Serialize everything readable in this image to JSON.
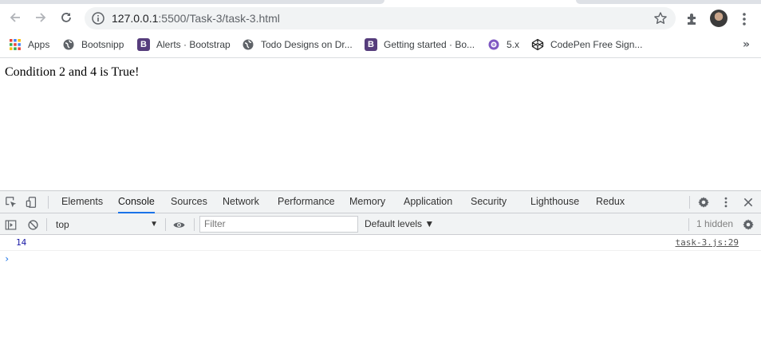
{
  "browser": {
    "url_host": "127.0.0.1",
    "url_rest": ":5500/Task-3/task-3.html",
    "icons": {
      "back": "arrow-left-icon",
      "forward": "arrow-right-icon",
      "reload": "reload-icon",
      "site_info": "info-icon",
      "bookmark_star": "star-icon",
      "extensions": "puzzle-icon",
      "menu": "vertical-dots-icon"
    }
  },
  "bookmarks": {
    "items": [
      {
        "label": "Apps",
        "icon": "apps-grid-icon"
      },
      {
        "label": "Bootsnipp",
        "icon": "globe-icon"
      },
      {
        "label": "Alerts · Bootstrap",
        "icon": "bootstrap-icon"
      },
      {
        "label": "Todo Designs on Dr...",
        "icon": "globe-icon"
      },
      {
        "label": "Getting started · Bo...",
        "icon": "bootstrap-icon"
      },
      {
        "label": "5.x",
        "icon": "purple-ring-icon"
      },
      {
        "label": "CodePen Free Sign...",
        "icon": "codepen-icon"
      }
    ],
    "more": "»"
  },
  "page": {
    "text": "Condition 2 and 4 is True!"
  },
  "devtools": {
    "tabs": [
      {
        "label": "Elements",
        "active": false
      },
      {
        "label": "Console",
        "active": true
      },
      {
        "label": "Sources",
        "active": false
      },
      {
        "label": "Network",
        "active": false
      },
      {
        "label": "Performance",
        "active": false
      },
      {
        "label": "Memory",
        "active": false
      },
      {
        "label": "Application",
        "active": false
      },
      {
        "label": "Security",
        "active": false
      },
      {
        "label": "Lighthouse",
        "active": false
      },
      {
        "label": "Redux",
        "active": false
      }
    ],
    "context": "top",
    "filter_placeholder": "Filter",
    "levels": "Default levels ▼",
    "hidden": "1 hidden",
    "console": {
      "entries": [
        {
          "value": "14",
          "source": "task-3.js:29"
        }
      ],
      "prompt": "›"
    },
    "accent_color": "#1a73e8"
  }
}
